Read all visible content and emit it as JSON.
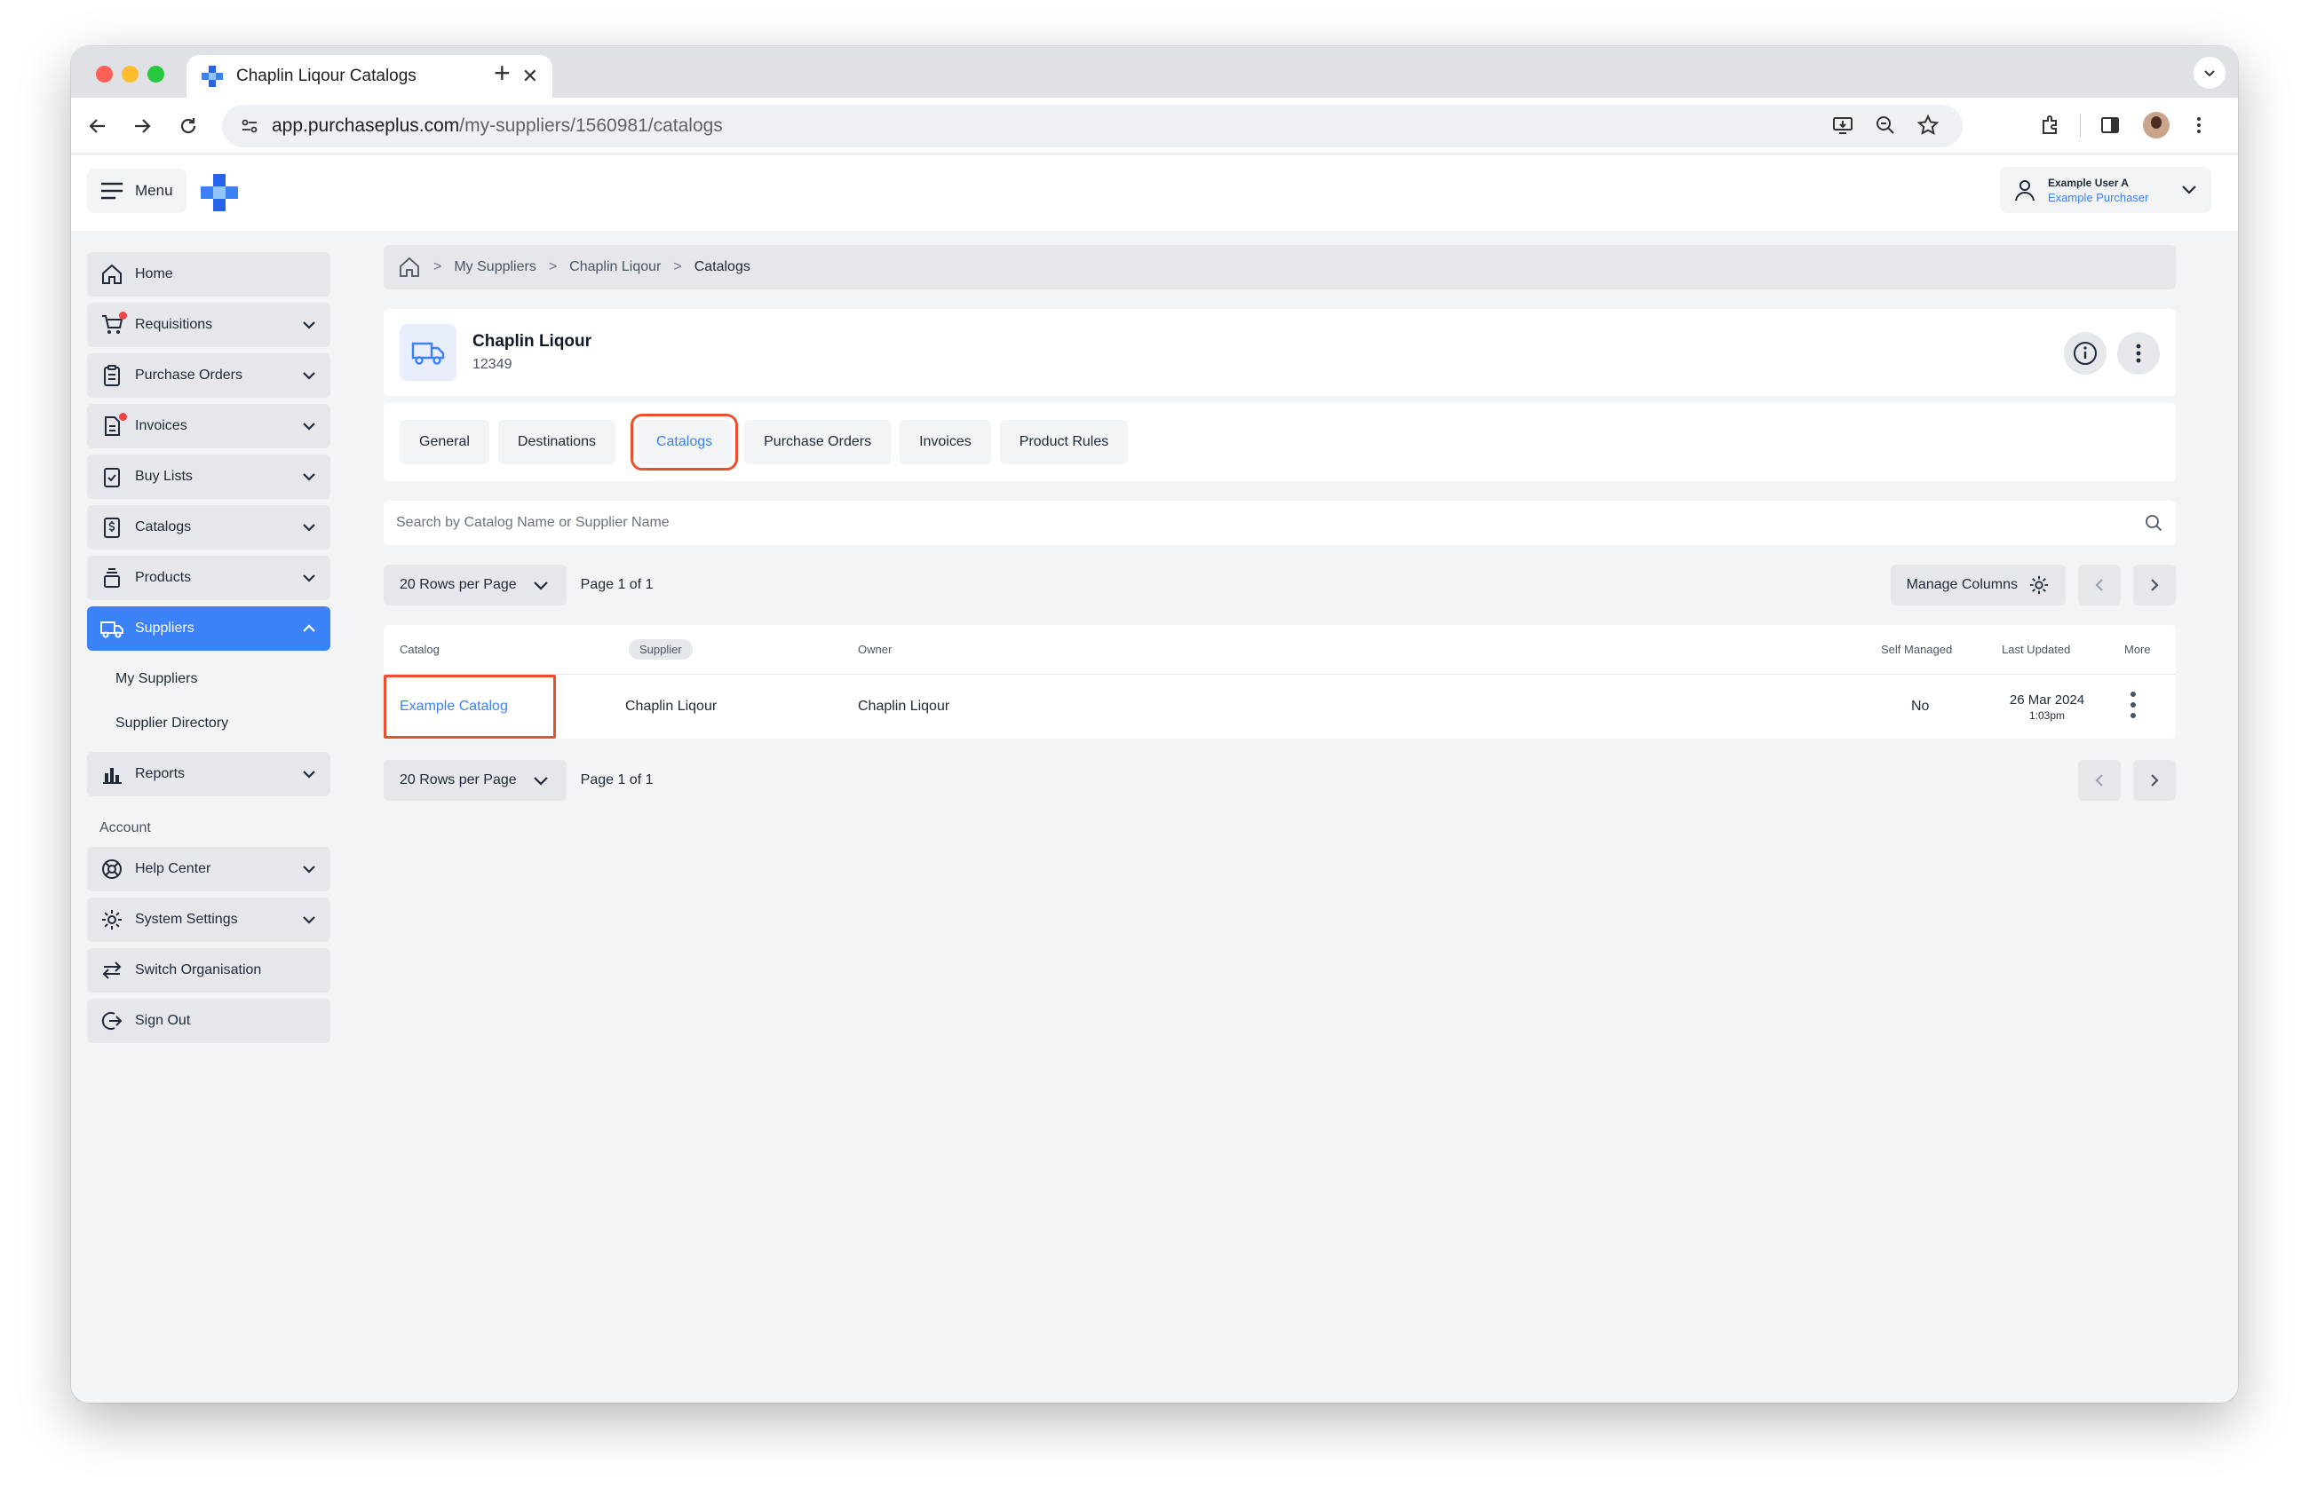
{
  "browser": {
    "tab_title": "Chaplin Liqour Catalogs",
    "new_tab": "+",
    "close": "✕",
    "url_host": "app.purchaseplus.com",
    "url_path": "/my-suppliers/1560981/catalogs"
  },
  "header": {
    "menu_label": "Menu",
    "user_name": "Example User A",
    "user_role": "Example Purchaser"
  },
  "sidebar": {
    "items": [
      {
        "label": "Home"
      },
      {
        "label": "Requisitions"
      },
      {
        "label": "Purchase Orders"
      },
      {
        "label": "Invoices"
      },
      {
        "label": "Buy Lists"
      },
      {
        "label": "Catalogs"
      },
      {
        "label": "Products"
      },
      {
        "label": "Suppliers"
      },
      {
        "label": "Reports"
      }
    ],
    "sub_items": [
      "My Suppliers",
      "Supplier Directory"
    ],
    "account_heading": "Account",
    "account_items": [
      {
        "label": "Help Center"
      },
      {
        "label": "System Settings"
      },
      {
        "label": "Switch Organisation"
      },
      {
        "label": "Sign Out"
      }
    ]
  },
  "breadcrumb": [
    "My Suppliers",
    "Chaplin Liqour",
    "Catalogs"
  ],
  "supplier": {
    "name": "Chaplin Liqour",
    "id": "12349"
  },
  "tabs": [
    "General",
    "Destinations",
    "Catalogs",
    "Purchase Orders",
    "Invoices",
    "Product Rules"
  ],
  "active_tab": "Catalogs",
  "search": {
    "placeholder": "Search by Catalog Name or Supplier Name"
  },
  "pager": {
    "rows_label": "20 Rows per Page",
    "page_text": "Page 1 of 1",
    "manage_columns": "Manage Columns"
  },
  "table": {
    "headers": {
      "catalog": "Catalog",
      "supplier": "Supplier",
      "owner": "Owner",
      "self_managed": "Self Managed",
      "last_updated": "Last Updated",
      "more": "More"
    },
    "rows": [
      {
        "catalog": "Example Catalog",
        "supplier": "Chaplin Liqour",
        "owner": "Chaplin Liqour",
        "self_managed": "No",
        "date": "26 Mar 2024",
        "time": "1:03pm"
      }
    ]
  },
  "colors": {
    "accent": "#3b82f6",
    "highlight": "#e8502e",
    "notification": "#ef4444"
  }
}
